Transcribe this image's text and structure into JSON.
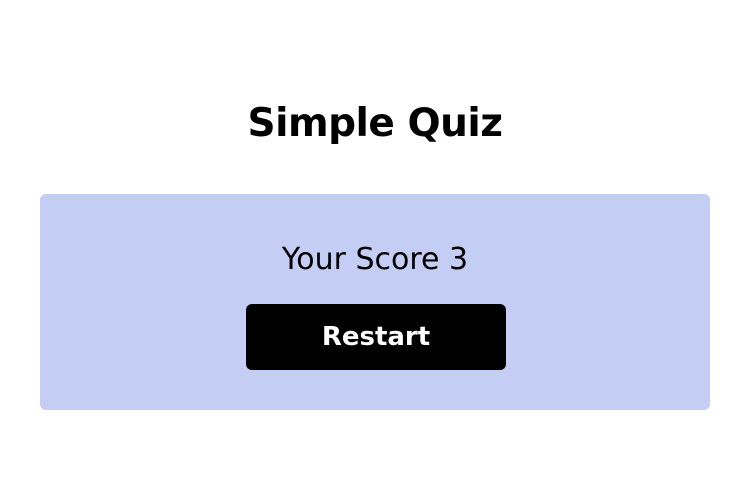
{
  "app": {
    "title": "Simple Quiz"
  },
  "result": {
    "score_text": "Your Score 3",
    "restart_label": "Restart"
  },
  "colors": {
    "panel_background": "#c4cdf4",
    "button_background": "#000000",
    "button_text": "#ffffff",
    "page_background": "#ffffff"
  }
}
